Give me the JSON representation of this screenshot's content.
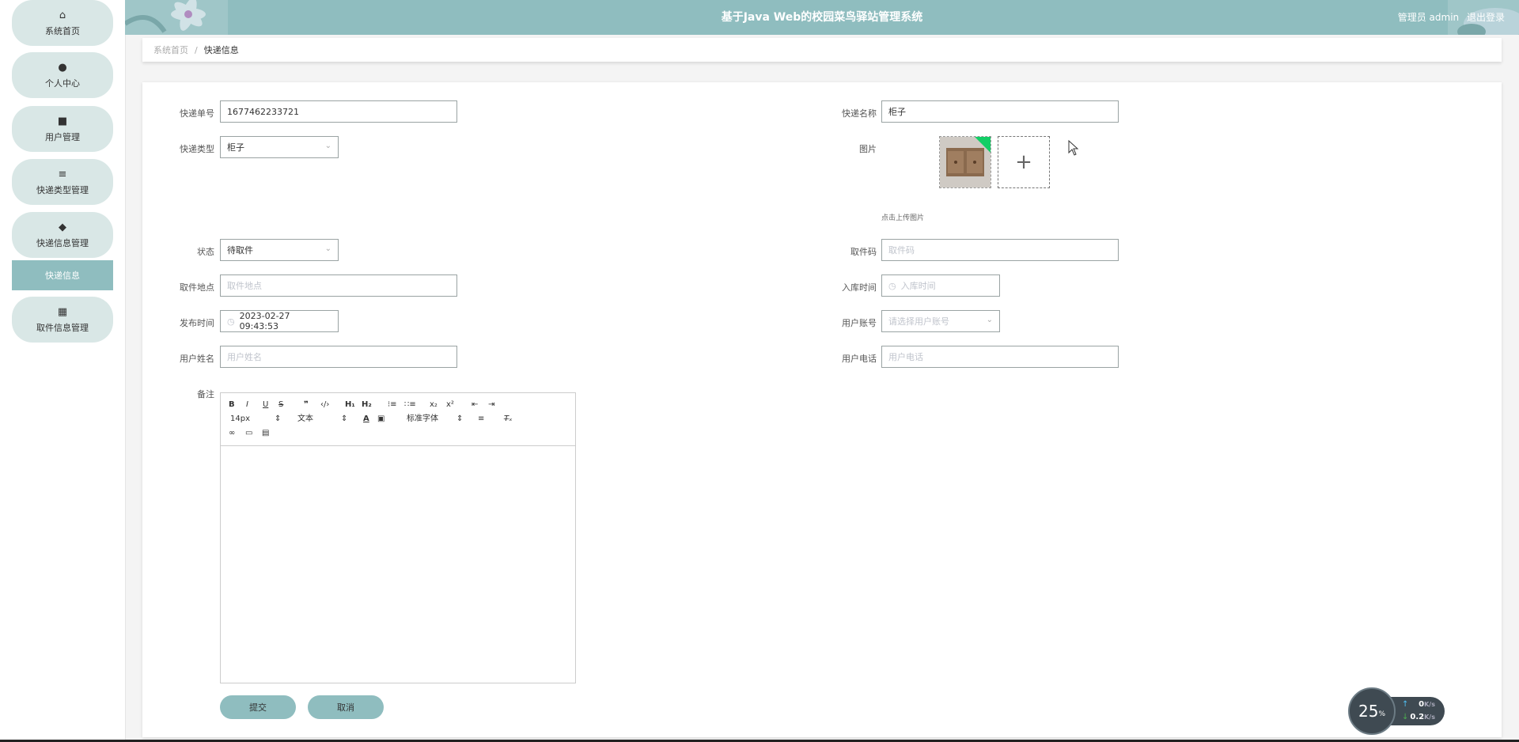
{
  "header": {
    "title": "基于Java Web的校园菜鸟驿站管理系统",
    "role": "管理员 admin",
    "logout": "退出登录"
  },
  "sidebar": {
    "items": [
      {
        "label": "系统首页",
        "icon": "home-icon"
      },
      {
        "label": "个人中心",
        "icon": "user-icon"
      },
      {
        "label": "用户管理",
        "icon": "briefcase-icon"
      },
      {
        "label": "快递类型管理",
        "icon": "sliders-icon"
      },
      {
        "label": "快递信息管理",
        "icon": "pin-icon"
      },
      {
        "label": "取件信息管理",
        "icon": "grid-icon"
      }
    ],
    "active_sub": "快递信息"
  },
  "breadcrumb": {
    "home": "系统首页",
    "sep": "/",
    "current": "快递信息"
  },
  "form": {
    "tracking_no": {
      "label": "快递单号",
      "value": "1677462233721"
    },
    "express_name": {
      "label": "快递名称",
      "value": "柜子"
    },
    "express_type": {
      "label": "快递类型",
      "value": "柜子"
    },
    "image": {
      "label": "图片",
      "hint": "点击上传图片"
    },
    "status": {
      "label": "状态",
      "value": "待取件"
    },
    "pickup_code": {
      "label": "取件码",
      "placeholder": "取件码"
    },
    "pickup_place": {
      "label": "取件地点",
      "placeholder": "取件地点"
    },
    "storage_time": {
      "label": "入库时间",
      "placeholder": "入库时间"
    },
    "publish_time": {
      "label": "发布时间",
      "value": "2023-02-27 09:43:53"
    },
    "user_account": {
      "label": "用户账号",
      "placeholder": "请选择用户账号"
    },
    "user_name": {
      "label": "用户姓名",
      "placeholder": "用户姓名"
    },
    "user_phone": {
      "label": "用户电话",
      "placeholder": "用户电话"
    },
    "remark": {
      "label": "备注"
    }
  },
  "editor": {
    "font_size": "14px",
    "header_select": "文本",
    "font_family": "标准字体"
  },
  "buttons": {
    "submit": "提交",
    "cancel": "取消"
  },
  "net_widget": {
    "percent": "25",
    "percent_unit": "%",
    "up": "0",
    "down": "0.2",
    "unit": "K/s"
  },
  "colors": {
    "accent": "#8fbdbf",
    "menu_bg": "#d9e7e6"
  }
}
